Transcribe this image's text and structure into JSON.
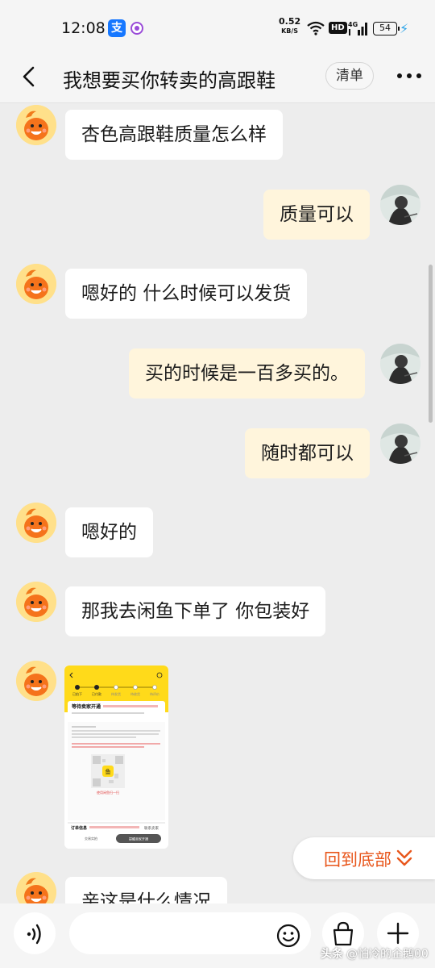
{
  "status_bar": {
    "time": "12:08",
    "net_speed_value": "0.52",
    "net_speed_unit": "KB/S",
    "hd_label": "HD",
    "network_type": "4G",
    "battery_level": "54",
    "icons": [
      "alipay-icon",
      "notification-dot-icon",
      "wifi-icon",
      "hd-icon",
      "signal-icon",
      "battery-icon",
      "charging-icon"
    ]
  },
  "header": {
    "title": "我想要买你转卖的高跟鞋",
    "list_button_label": "清单",
    "icons": [
      "back-icon",
      "more-icon"
    ]
  },
  "messages": [
    {
      "side": "left",
      "text": "杏色高跟鞋质量怎么样"
    },
    {
      "side": "right",
      "text": "质量可以"
    },
    {
      "side": "left",
      "text": "嗯好的 什么时候可以发货"
    },
    {
      "side": "right",
      "text": "买的时候是一百多买的。"
    },
    {
      "side": "right",
      "text": "随时都可以"
    },
    {
      "side": "left",
      "text": "嗯好的"
    },
    {
      "side": "left",
      "text": "那我去闲鱼下单了 你包装好"
    },
    {
      "side": "left",
      "type": "image",
      "text": "order-screenshot"
    },
    {
      "side": "left",
      "text": "亲这是什么情况"
    }
  ],
  "image_message": {
    "steps": [
      "已拍下",
      "已付款",
      "待发货",
      "待收货",
      "待评价"
    ],
    "status_title": "等待卖家开通",
    "qr_label": "鱼",
    "qr_caption": "使用闲鱼扫一扫",
    "order_info_label": "订单信息",
    "contact_label": "联系卖家",
    "secondary_button_label": "交易实拍",
    "primary_button_label": "提醒卖家开通"
  },
  "back_to_bottom": {
    "label": "回到底部"
  },
  "input_bar": {
    "placeholder": "",
    "icons": [
      "voice-icon",
      "emoji-icon",
      "shopping-bag-icon",
      "plus-icon"
    ]
  },
  "watermark": {
    "brand": "头条",
    "handle": "@怕冷的企鹅00"
  },
  "colors": {
    "accent": "#e8561b",
    "outgoing_bubble": "#fff5dc",
    "incoming_bubble": "#ffffff",
    "background": "#ededed",
    "xianyu_yellow": "#ffda1a"
  }
}
